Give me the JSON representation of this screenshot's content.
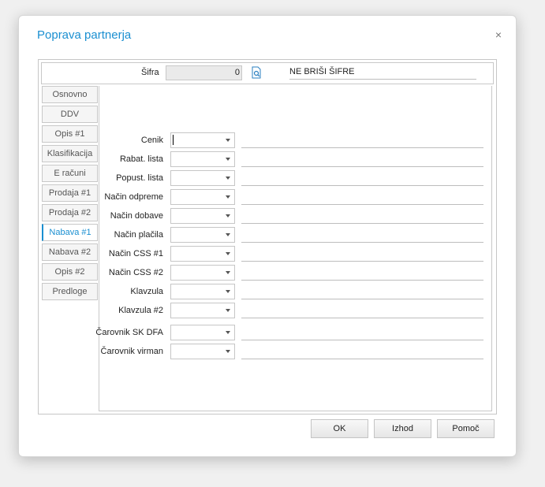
{
  "dialog": {
    "title": "Poprava partnerja",
    "close_symbol": "×"
  },
  "header": {
    "sifra_label": "Šifra",
    "sifra_value": "0",
    "ne_brisi": "NE BRIŠI ŠIFRE"
  },
  "tabs": [
    {
      "label": "Osnovno",
      "active": false
    },
    {
      "label": "DDV",
      "active": false
    },
    {
      "label": "Opis #1",
      "active": false
    },
    {
      "label": "Klasifikacija",
      "active": false
    },
    {
      "label": "E računi",
      "active": false
    },
    {
      "label": "Prodaja #1",
      "active": false
    },
    {
      "label": "Prodaja #2",
      "active": false
    },
    {
      "label": "Nabava #1",
      "active": true
    },
    {
      "label": "Nabava #2",
      "active": false
    },
    {
      "label": "Opis #2",
      "active": false
    },
    {
      "label": "Predloge",
      "active": false
    }
  ],
  "fields": [
    {
      "label": "Cenik"
    },
    {
      "label": "Rabat. lista"
    },
    {
      "label": "Popust. lista"
    },
    {
      "label": "Način odpreme"
    },
    {
      "label": "Način dobave"
    },
    {
      "label": "Način plačila"
    },
    {
      "label": "Način CSS #1"
    },
    {
      "label": "Način CSS #2"
    },
    {
      "label": "Klavzula"
    },
    {
      "label": "Klavzula #2"
    },
    {
      "label": "Čarovnik SK DFA"
    },
    {
      "label": "Čarovnik virman"
    }
  ],
  "buttons": {
    "ok": "OK",
    "izhod": "Izhod",
    "pomoc": "Pomoč"
  },
  "colors": {
    "accent": "#1a8fd1"
  }
}
